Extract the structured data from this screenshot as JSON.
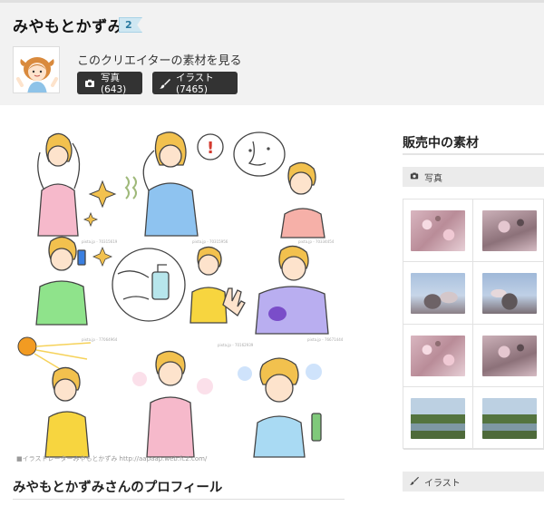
{
  "creator": {
    "name": "みやもとかずみ",
    "level": "2",
    "view_works_link": "このクリエイターの素材を見る"
  },
  "buttons": {
    "photo_label": "写真 (643)",
    "photo_icon": "camera-icon",
    "illust_label": "イラスト (7465)",
    "illust_icon": "brush-icon"
  },
  "main_image": {
    "watermark": "■イラストレーターみやもとかずみ http://aapaap.web.fc2.com/"
  },
  "profile": {
    "title": "みやもとかずみさんのプロフィール"
  },
  "sidebar": {
    "title": "販売中の素材",
    "photo_category": "写真",
    "illust_category": "イラスト",
    "thumbnails": [
      "cherry-blossom",
      "cherry-blossom",
      "blossom-sky",
      "blossom-sky",
      "cherry-blossom",
      "cherry-blossom",
      "river",
      "river"
    ]
  },
  "colors": {
    "header_bg": "#f2f2f2",
    "button_bg": "#333333",
    "badge_bg": "#cfe7f2"
  }
}
